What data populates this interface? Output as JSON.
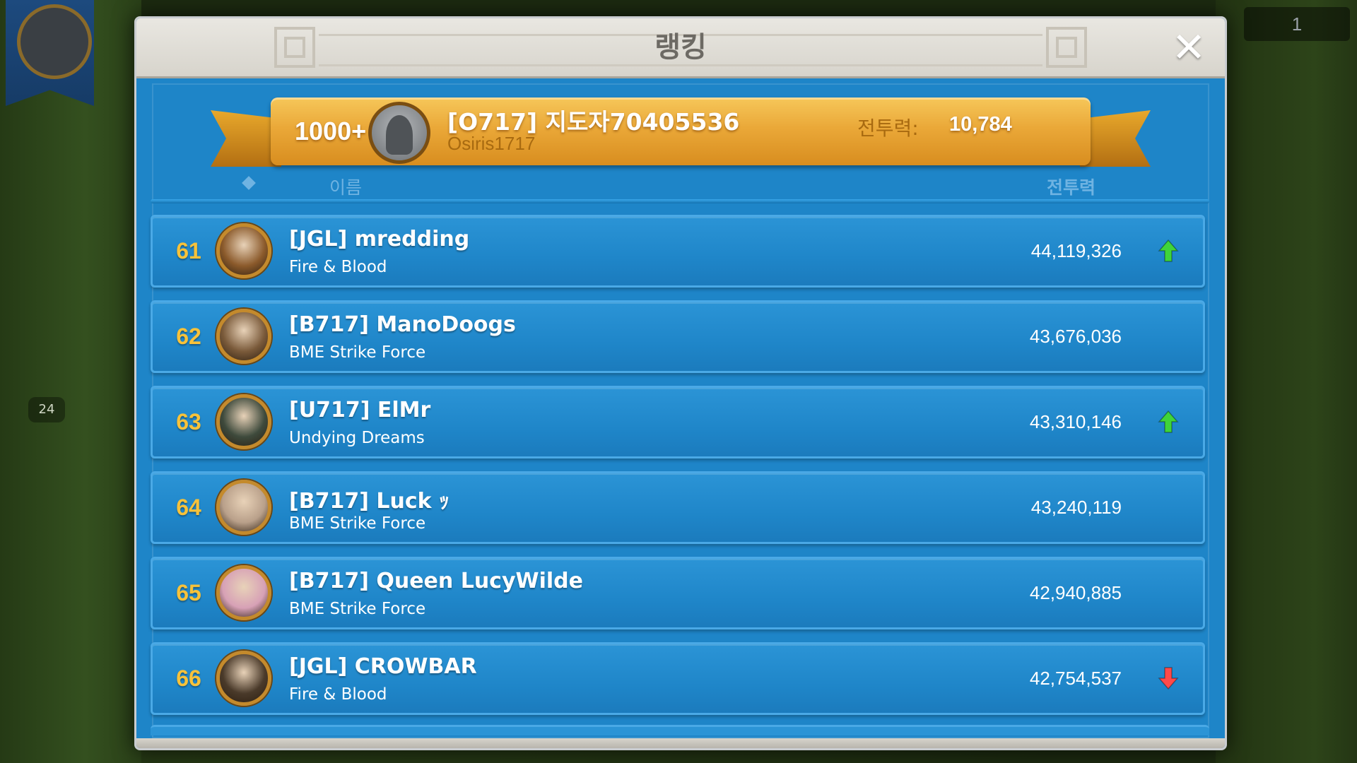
{
  "window": {
    "title": "랭킹",
    "close_label": "✕"
  },
  "background": {
    "top_right_count": "1",
    "map_badge": "24"
  },
  "player": {
    "rank": "1000+",
    "name": "[O717] 지도자70405536",
    "alliance": "Osiris1717",
    "power_label": "전투력:",
    "power_value": "10,784"
  },
  "columns": {
    "name": "이름",
    "power": "전투력"
  },
  "rows": [
    {
      "rank": "61",
      "name": "[JGL] mredding",
      "alliance": "Fire & Blood",
      "power": "44,119,326",
      "trend": "up",
      "avatar_color": "#8b5a2b"
    },
    {
      "rank": "62",
      "name": "[B717] ManoDoogs",
      "alliance": "BME Strike Force",
      "power": "43,676,036",
      "trend": "none",
      "avatar_color": "#7a5a3a"
    },
    {
      "rank": "63",
      "name": "[U717] ElMr",
      "alliance": "Undying Dreams",
      "power": "43,310,146",
      "trend": "up",
      "avatar_color": "#3e4a3c"
    },
    {
      "rank": "64",
      "name": "[B717] Luck ｯ",
      "alliance": "BME Strike Force",
      "power": "43,240,119",
      "trend": "none",
      "avatar_color": "#b9a08a"
    },
    {
      "rank": "65",
      "name": "[B717] Queen LucyWilde",
      "alliance": "BME Strike Force",
      "power": "42,940,885",
      "trend": "none",
      "avatar_color": "#d7a1b6"
    },
    {
      "rank": "66",
      "name": "[JGL] CROWBAR",
      "alliance": "Fire & Blood",
      "power": "42,754,537",
      "trend": "down",
      "avatar_color": "#4a3a2a"
    }
  ],
  "colors": {
    "panel_blue": "#1e85c8",
    "rank_gold": "#f7c23a",
    "trend_up": "#3fd43a",
    "trend_down": "#ff4a4a",
    "ribbon_gold": "#eaa838"
  },
  "icons": {
    "close": "close-icon",
    "sort": "diamond-sort-icon",
    "trend_up": "arrow-up-icon",
    "trend_down": "arrow-down-icon"
  }
}
